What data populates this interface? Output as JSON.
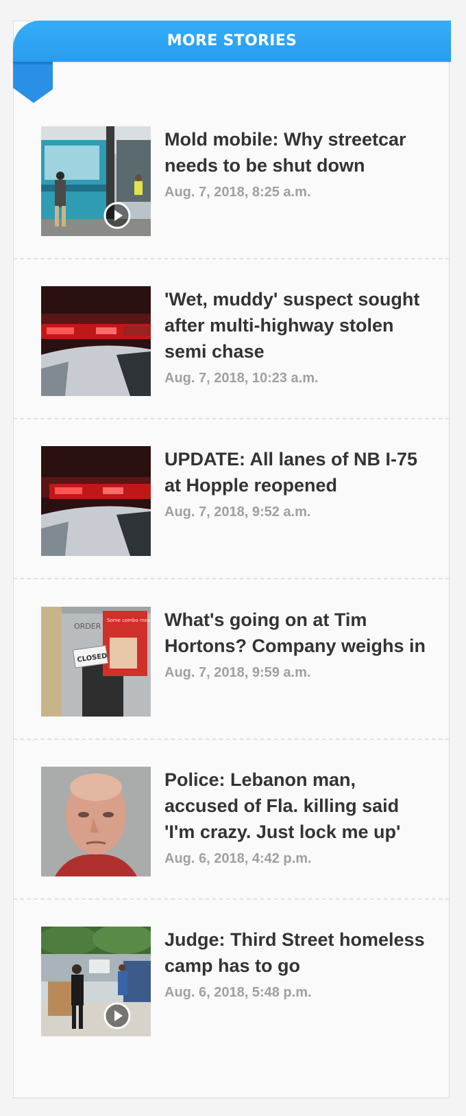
{
  "section_title": "MORE STORIES",
  "colors": {
    "ribbon": "#2a9cf0",
    "headline": "#333333",
    "date": "#a0a0a0"
  },
  "stories": [
    {
      "headline": "Mold mobile: Why streetcar needs to be shut down",
      "date": "Aug. 7, 2018, 8:25 a.m.",
      "has_video": true,
      "thumb_icon": "streetcar-photo"
    },
    {
      "headline": "'Wet, muddy' suspect sought after multi-highway stolen semi chase",
      "date": "Aug. 7, 2018, 10:23 a.m.",
      "has_video": false,
      "thumb_icon": "police-lights-photo"
    },
    {
      "headline": "UPDATE: All lanes of NB I-75 at Hopple reopened",
      "date": "Aug. 7, 2018, 9:52 a.m.",
      "has_video": false,
      "thumb_icon": "police-lights-photo"
    },
    {
      "headline": "What's going on at Tim Hortons? Company weighs in",
      "date": "Aug. 7, 2018, 9:59 a.m.",
      "has_video": false,
      "thumb_icon": "drive-thru-closed-photo",
      "thumb_text": {
        "sign_left": "ORDER H",
        "closed": "CLOSED",
        "notice": "Some combo meal numbers have changed."
      }
    },
    {
      "headline": "Police: Lebanon man, accused of Fla. killing said 'I'm crazy. Just lock me up'",
      "date": "Aug. 6, 2018, 4:42 p.m.",
      "has_video": false,
      "thumb_icon": "mugshot-photo"
    },
    {
      "headline": "Judge: Third Street homeless camp has to go",
      "date": "Aug. 6, 2018, 5:48 p.m.",
      "has_video": true,
      "thumb_icon": "homeless-camp-photo"
    }
  ]
}
